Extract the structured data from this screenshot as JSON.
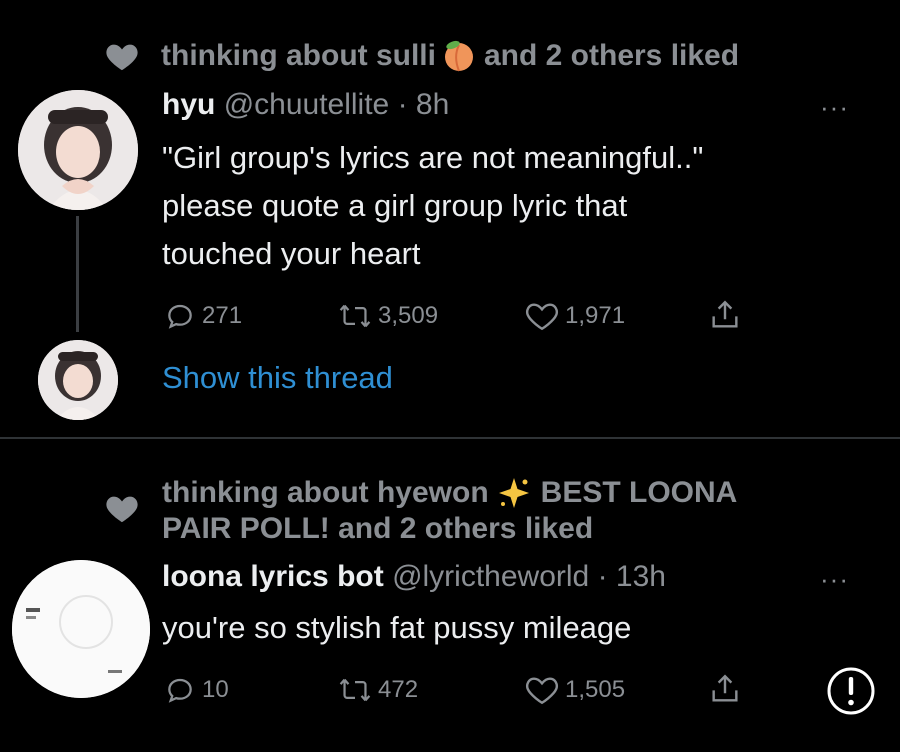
{
  "tweets": [
    {
      "social": {
        "text_before": "thinking about sulli",
        "text_after": "and 2 others liked",
        "emoji_icon": "peach-icon"
      },
      "name": "hyu",
      "handle": "@chuutellite",
      "time": "· 8h",
      "lines": [
        "\"Girl group's lyrics are not meaningful..\"",
        "please quote a girl group lyric that",
        "touched your heart"
      ],
      "replies": "271",
      "retweets": "3,509",
      "likes": "1,971",
      "more": "···"
    },
    {
      "social": {
        "line1_before": "thinking about hyewon",
        "line1_after": "BEST LOONA",
        "line2": "PAIR POLL! and 2 others liked",
        "emoji_icon": "sparkle-star-icon"
      },
      "name": "loona lyrics bot",
      "handle": "@lyrictheworld",
      "time": "· 13h",
      "lines": [
        "you're so stylish fat pussy mileage"
      ],
      "replies": "10",
      "retweets": "472",
      "likes": "1,505",
      "more": "···"
    }
  ],
  "thread_link": "Show this thread",
  "colors": {
    "background": "#000000",
    "muted": "#8b8f94",
    "link": "#2f8fd3",
    "text": "#eceef0",
    "divider": "#2f3336"
  }
}
